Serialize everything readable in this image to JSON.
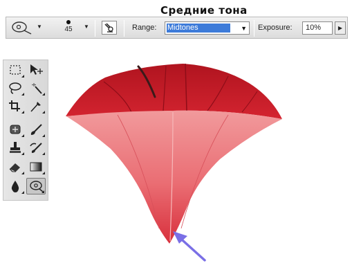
{
  "caption": "Средние тона",
  "options_bar": {
    "tool_preset_icon": "dodge-tool-icon",
    "brush_size": "45",
    "airbrush_icon": "airbrush-icon",
    "range_label": "Range:",
    "range_value": "Midtones",
    "exposure_label": "Exposure:",
    "exposure_value": "10%"
  },
  "toolbox": {
    "tools": [
      {
        "name": "rectangular-marquee-tool",
        "icon": "marquee-icon"
      },
      {
        "name": "move-tool",
        "icon": "move-icon"
      },
      {
        "name": "lasso-tool",
        "icon": "lasso-icon"
      },
      {
        "name": "magic-wand-tool",
        "icon": "magic-wand-icon"
      },
      {
        "name": "crop-tool",
        "icon": "crop-icon"
      },
      {
        "name": "eyedropper-tool",
        "icon": "eyedropper-icon"
      },
      {
        "name": "healing-brush-tool",
        "icon": "healing-brush-icon"
      },
      {
        "name": "brush-tool",
        "icon": "brush-icon"
      },
      {
        "name": "clone-stamp-tool",
        "icon": "stamp-icon"
      },
      {
        "name": "history-brush-tool",
        "icon": "history-brush-icon"
      },
      {
        "name": "eraser-tool",
        "icon": "eraser-icon"
      },
      {
        "name": "gradient-tool",
        "icon": "gradient-icon"
      },
      {
        "name": "blur-tool",
        "icon": "blur-drop-icon"
      },
      {
        "name": "dodge-tool",
        "icon": "dodge-tool-icon"
      }
    ],
    "active_tool": "dodge-tool"
  },
  "canvas": {
    "subject_icon": "flower-image",
    "arrow_color": "#7a6fe6",
    "flower_colors": [
      "#c41f2c",
      "#e8505a",
      "#f18a8c"
    ]
  }
}
